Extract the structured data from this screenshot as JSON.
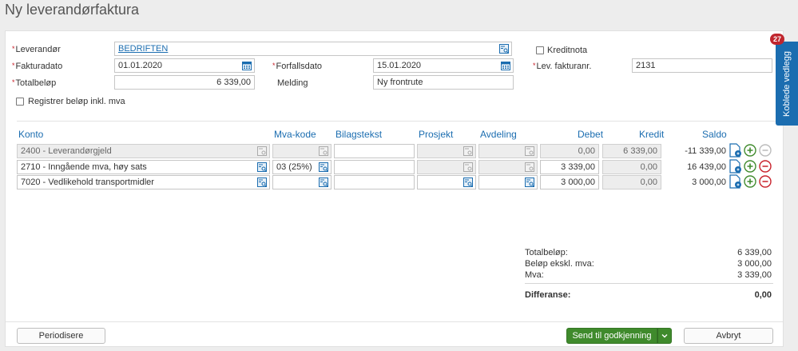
{
  "page": {
    "title": "Ny leverandørfaktura"
  },
  "header_form": {
    "leverandor": {
      "label": "Leverandør",
      "value": "BEDRIFTEN"
    },
    "kreditnota": {
      "label": "Kreditnota",
      "checked": false
    },
    "fakturadato": {
      "label": "Fakturadato",
      "value": "01.01.2020"
    },
    "forfallsdato": {
      "label": "Forfallsdato",
      "value": "15.01.2020"
    },
    "lev_fakturanr": {
      "label": "Lev. fakturanr.",
      "value": "2131"
    },
    "totalbelop": {
      "label": "Totalbeløp",
      "value": "6 339,00"
    },
    "melding": {
      "label": "Melding",
      "value": "Ny frontrute"
    },
    "registrer_inkl_mva": {
      "label": "Registrer beløp inkl. mva",
      "checked": false
    }
  },
  "table": {
    "headers": {
      "konto": "Konto",
      "mva_kode": "Mva-kode",
      "bilagstekst": "Bilagstekst",
      "prosjekt": "Prosjekt",
      "avdeling": "Avdeling",
      "debet": "Debet",
      "kredit": "Kredit",
      "saldo": "Saldo"
    },
    "rows": [
      {
        "konto": "2400 - Leverandørgjeld",
        "mva_kode": "",
        "bilagstekst": "",
        "prosjekt": "",
        "avdeling": "",
        "debet": "0,00",
        "kredit": "6 339,00",
        "saldo": "-11 339,00"
      },
      {
        "konto": "2710 - Inngående mva, høy sats",
        "mva_kode": "03 (25%)",
        "bilagstekst": "",
        "prosjekt": "",
        "avdeling": "",
        "debet": "3 339,00",
        "kredit": "0,00",
        "saldo": "16 439,00"
      },
      {
        "konto": "7020 - Vedlikehold transportmidler",
        "mva_kode": "",
        "bilagstekst": "",
        "prosjekt": "",
        "avdeling": "",
        "debet": "3 000,00",
        "kredit": "0,00",
        "saldo": "3 000,00"
      }
    ]
  },
  "summary": {
    "totalbelop": {
      "label": "Totalbeløp:",
      "value": "6 339,00"
    },
    "belop_ekskl_mva": {
      "label": "Beløp ekskl. mva:",
      "value": "3 000,00"
    },
    "mva": {
      "label": "Mva:",
      "value": "3 339,00"
    },
    "differanse": {
      "label": "Differanse:",
      "value": "0,00"
    }
  },
  "footer": {
    "periodisere": "Periodisere",
    "send": "Send til godkjenning",
    "avbryt": "Avbryt"
  },
  "side_tab": {
    "label": "Koblede vedlegg",
    "badge": "27"
  },
  "colors": {
    "accent": "#1b6db0",
    "green": "#3f8a2c",
    "red": "#c8202a",
    "required": "#c8202a"
  },
  "icons": {
    "lookup": "lookup-icon",
    "calendar": "calendar-icon",
    "document": "document-icon",
    "add": "add-circle-icon",
    "remove": "remove-circle-icon"
  }
}
